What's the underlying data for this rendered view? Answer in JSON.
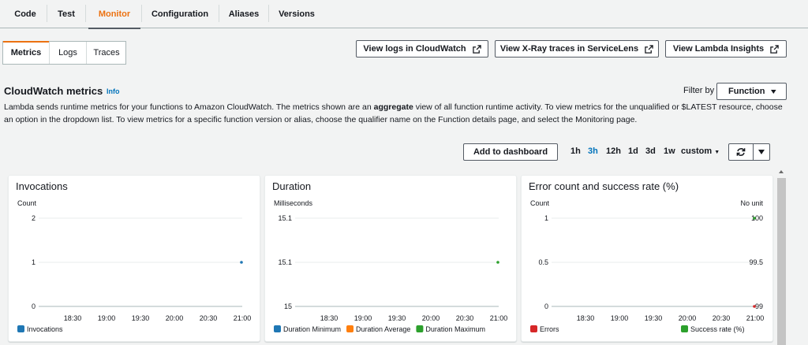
{
  "top_tabs": [
    "Code",
    "Test",
    "Monitor",
    "Configuration",
    "Aliases",
    "Versions"
  ],
  "sub_tabs": [
    "Metrics",
    "Logs",
    "Traces"
  ],
  "buttons": {
    "view_logs": "View logs in CloudWatch",
    "view_xray": "View X-Ray traces in ServiceLens",
    "view_insights": "View Lambda Insights",
    "add_dashboard": "Add to dashboard"
  },
  "section": {
    "title": "CloudWatch metrics",
    "info": "Info",
    "desc_part1": "Lambda sends runtime metrics for your functions to Amazon CloudWatch. The metrics shown are an ",
    "desc_bold": "aggregate",
    "desc_part2": " view of all function runtime activity. To view metrics for the unqualified or $LATEST resource, choose an option in the dropdown list. To view metrics for a specific function version or alias, choose the qualifier name on the Function details page, and select the Monitoring page."
  },
  "filter": {
    "label": "Filter by",
    "value": "Function"
  },
  "time_ranges": [
    "1h",
    "3h",
    "12h",
    "1d",
    "3d",
    "1w"
  ],
  "time_range_active": "3h",
  "custom_label": "custom",
  "colors": {
    "accent": "#ec7211",
    "link": "#0073bb",
    "blue": "#1f77b4",
    "orange": "#ff7f0e",
    "green": "#2ca02c",
    "red": "#d62728"
  },
  "chart_data": [
    {
      "type": "line",
      "title": "Invocations",
      "ylabel": "Count",
      "ylim": [
        0,
        2
      ],
      "y_ticks": [
        "2",
        "1",
        "0"
      ],
      "x_ticks": [
        "18:30",
        "19:00",
        "19:30",
        "20:00",
        "20:30",
        "21:00"
      ],
      "series": [
        {
          "name": "Invocations",
          "color": "#1f77b4",
          "points": [
            {
              "x": "21:00",
              "y": 1
            }
          ]
        }
      ]
    },
    {
      "type": "line",
      "title": "Duration",
      "ylabel": "Milliseconds",
      "ylim": [
        15,
        15.1
      ],
      "y_ticks": [
        "15.1",
        "15.1",
        "15"
      ],
      "x_ticks": [
        "18:30",
        "19:00",
        "19:30",
        "20:00",
        "20:30",
        "21:00"
      ],
      "series": [
        {
          "name": "Duration Minimum",
          "color": "#1f77b4",
          "points": []
        },
        {
          "name": "Duration Average",
          "color": "#ff7f0e",
          "points": []
        },
        {
          "name": "Duration Maximum",
          "color": "#2ca02c",
          "points": [
            {
              "x": "21:00",
              "y": 15.05
            }
          ]
        }
      ]
    },
    {
      "type": "line",
      "title": "Error count and success rate (%)",
      "ylabel": "Count",
      "ylabel_right": "No unit",
      "ylim": [
        0,
        1
      ],
      "ylim_right": [
        99,
        100
      ],
      "y_ticks": [
        "1",
        "0.5",
        "0"
      ],
      "y_ticks_right": [
        "100",
        "99.5",
        "99"
      ],
      "x_ticks": [
        "18:30",
        "19:00",
        "19:30",
        "20:00",
        "20:30",
        "21:00"
      ],
      "series": [
        {
          "name": "Errors",
          "color": "#d62728",
          "points": [
            {
              "x": "21:00",
              "y": 0
            }
          ]
        },
        {
          "name": "Success rate (%)",
          "color": "#2ca02c",
          "axis": "right",
          "points": [
            {
              "x": "21:00",
              "y": 100
            }
          ]
        }
      ]
    }
  ]
}
